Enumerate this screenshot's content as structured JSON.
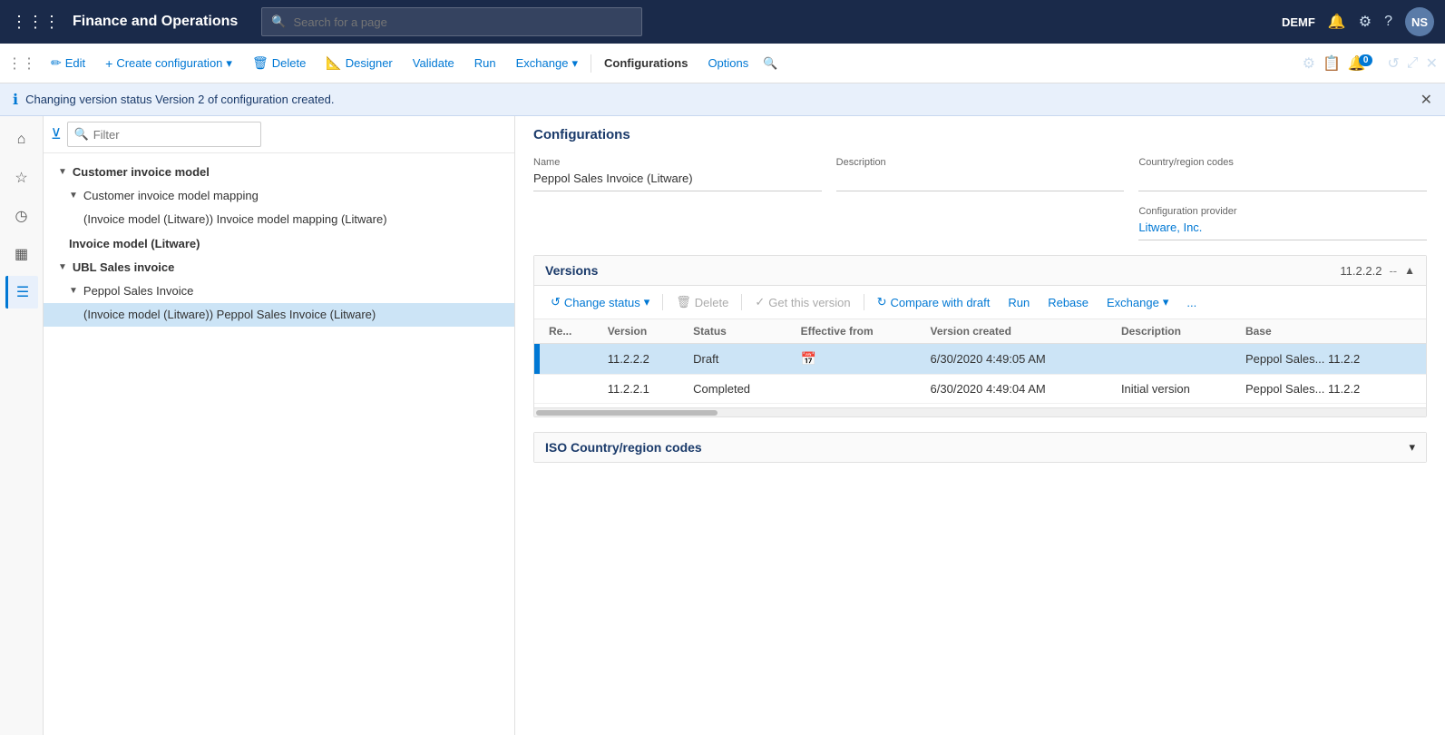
{
  "app": {
    "title": "Finance and Operations",
    "env": "DEMF",
    "user_initials": "NS",
    "search_placeholder": "Search for a page"
  },
  "toolbar": {
    "edit_label": "Edit",
    "create_config_label": "Create configuration",
    "delete_label": "Delete",
    "designer_label": "Designer",
    "validate_label": "Validate",
    "run_label": "Run",
    "exchange_label": "Exchange",
    "configurations_label": "Configurations",
    "options_label": "Options"
  },
  "info_bar": {
    "message": "Changing version status   Version 2 of configuration created."
  },
  "filter": {
    "placeholder": "Filter"
  },
  "tree": {
    "items": [
      {
        "label": "Customer invoice model",
        "level": 0,
        "expanded": true,
        "bold": true
      },
      {
        "label": "Customer invoice model mapping",
        "level": 1,
        "expanded": true,
        "bold": false
      },
      {
        "label": "(Invoice model (Litware)) Invoice model mapping (Litware)",
        "level": 2,
        "expanded": false,
        "bold": false
      },
      {
        "label": "Invoice model (Litware)",
        "level": 1,
        "expanded": false,
        "bold": true
      },
      {
        "label": "UBL Sales invoice",
        "level": 0,
        "expanded": true,
        "bold": true
      },
      {
        "label": "Peppol Sales Invoice",
        "level": 1,
        "expanded": true,
        "bold": false
      },
      {
        "label": "(Invoice model (Litware)) Peppol Sales Invoice (Litware)",
        "level": 2,
        "expanded": false,
        "bold": false,
        "selected": true
      }
    ]
  },
  "configurations": {
    "section_title": "Configurations",
    "name_label": "Name",
    "name_value": "Peppol Sales Invoice (Litware)",
    "description_label": "Description",
    "description_value": "",
    "country_region_codes_label": "Country/region codes",
    "country_region_codes_value": "",
    "config_provider_label": "Configuration provider",
    "config_provider_value": "Litware, Inc."
  },
  "versions": {
    "section_title": "Versions",
    "version_number": "11.2.2.2",
    "toolbar": {
      "change_status_label": "Change status",
      "delete_label": "Delete",
      "get_this_version_label": "Get this version",
      "compare_with_draft_label": "Compare with draft",
      "run_label": "Run",
      "rebase_label": "Rebase",
      "exchange_label": "Exchange",
      "more_label": "..."
    },
    "table_headers": [
      "Re...",
      "Version",
      "Status",
      "Effective from",
      "Version created",
      "Description",
      "Base"
    ],
    "rows": [
      {
        "indicator": true,
        "version": "11.2.2.2",
        "status": "Draft",
        "effective_from": "",
        "version_created": "6/30/2020 4:49:05 AM",
        "description": "",
        "base": "Peppol Sales...",
        "base_version": "11.2.2",
        "selected": true
      },
      {
        "indicator": false,
        "version": "11.2.2.1",
        "status": "Completed",
        "effective_from": "",
        "version_created": "6/30/2020 4:49:04 AM",
        "description": "Initial version",
        "base": "Peppol Sales...",
        "base_version": "11.2.2",
        "selected": false
      }
    ]
  },
  "iso_section": {
    "title": "ISO Country/region codes"
  },
  "sidebar_icons": [
    {
      "name": "home-icon",
      "symbol": "⌂",
      "active": false
    },
    {
      "name": "star-icon",
      "symbol": "☆",
      "active": false
    },
    {
      "name": "clock-icon",
      "symbol": "◷",
      "active": false
    },
    {
      "name": "grid-icon",
      "symbol": "▦",
      "active": false
    },
    {
      "name": "list-icon",
      "symbol": "☰",
      "active": true
    }
  ]
}
